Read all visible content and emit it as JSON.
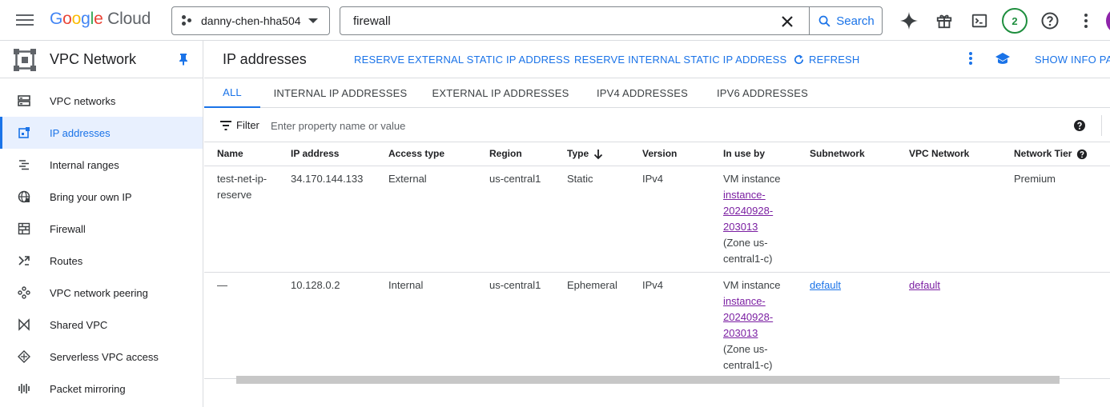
{
  "topbar": {
    "logo": {
      "g1": "G",
      "g2": "o",
      "g3": "o",
      "g4": "g",
      "g5": "l",
      "g6": "e",
      "cloud": " Cloud"
    },
    "project": "danny-chen-hha504",
    "search_value": "firewall",
    "search_button": "Search",
    "notification_count": "2"
  },
  "sidebar": {
    "title": "VPC Network",
    "items": [
      {
        "label": "VPC networks",
        "icon": "vpc-networks-icon"
      },
      {
        "label": "IP addresses",
        "icon": "ip-addresses-icon",
        "active": true
      },
      {
        "label": "Internal ranges",
        "icon": "internal-ranges-icon"
      },
      {
        "label": "Bring your own IP",
        "icon": "globe-icon"
      },
      {
        "label": "Firewall",
        "icon": "firewall-icon"
      },
      {
        "label": "Routes",
        "icon": "routes-icon"
      },
      {
        "label": "VPC network peering",
        "icon": "peering-icon"
      },
      {
        "label": "Shared VPC",
        "icon": "shared-vpc-icon"
      },
      {
        "label": "Serverless VPC access",
        "icon": "serverless-icon"
      },
      {
        "label": "Packet mirroring",
        "icon": "packet-mirroring-icon"
      }
    ]
  },
  "header": {
    "title": "IP addresses",
    "reserve_external": "RESERVE EXTERNAL STATIC IP ADDRESS",
    "reserve_internal": "RESERVE INTERNAL STATIC IP ADDRESS",
    "refresh": "REFRESH",
    "show_info_panel": "SHOW INFO PANEL"
  },
  "tabs": [
    "ALL",
    "INTERNAL IP ADDRESSES",
    "EXTERNAL IP ADDRESSES",
    "IPV4 ADDRESSES",
    "IPV6 ADDRESSES"
  ],
  "filter": {
    "label": "Filter",
    "placeholder": "Enter property name or value"
  },
  "table": {
    "columns": [
      "Name",
      "IP address",
      "Access type",
      "Region",
      "Type",
      "Version",
      "In use by",
      "Subnetwork",
      "VPC Network",
      "Network Tier"
    ],
    "rows": [
      {
        "name": "test-net-ip-reserve",
        "ip": "34.170.144.133",
        "access": "External",
        "region": "us-central1",
        "type": "Static",
        "version": "IPv4",
        "in_use_prefix": "VM instance",
        "in_use_link": "instance-20240928-203013",
        "in_use_zone": "(Zone us-central1-c)",
        "subnetwork": "",
        "vpc_network": "",
        "tier": "Premium"
      },
      {
        "name": "—",
        "ip": "10.128.0.2",
        "access": "Internal",
        "region": "us-central1",
        "type": "Ephemeral",
        "version": "IPv4",
        "in_use_prefix": "VM instance",
        "in_use_link": "instance-20240928-203013",
        "in_use_zone": "(Zone us-central1-c)",
        "subnetwork": "default",
        "vpc_network": "default",
        "tier": ""
      }
    ]
  },
  "colors": {
    "accent": "#1a73e8",
    "visited_link": "#7b1fa2",
    "active_bg": "#e8f0fe",
    "notification": "#1e8e3e",
    "avatar": "#8e24aa"
  }
}
